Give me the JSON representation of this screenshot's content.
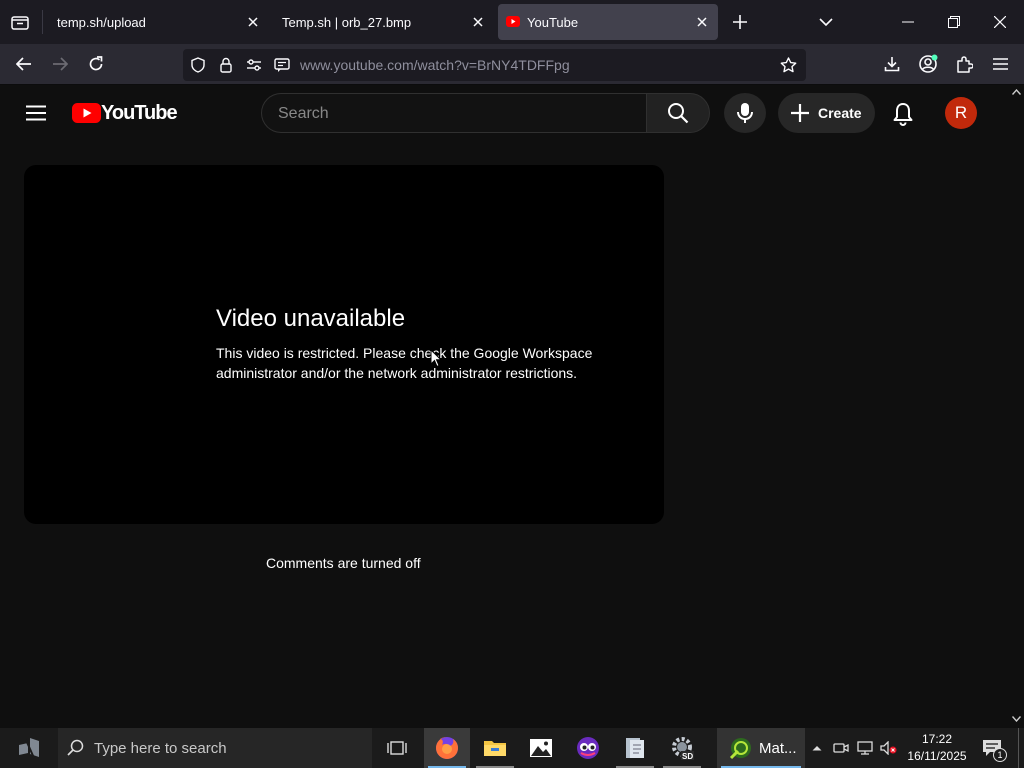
{
  "browser": {
    "tabs": [
      {
        "title": "temp.sh/upload",
        "active": false
      },
      {
        "title": "Temp.sh | orb_27.bmp",
        "active": false
      },
      {
        "title": "YouTube",
        "active": true
      }
    ],
    "url": "www.youtube.com/watch?v=BrNY4TDFFpg"
  },
  "youtube": {
    "logo_text": "YouTube",
    "search_placeholder": "Search",
    "create_label": "Create",
    "avatar_letter": "R",
    "error_title": "Video unavailable",
    "error_message": "This video is restricted. Please check the Google Workspace administrator and/or the network administrator restrictions.",
    "comments_status": "Comments are turned off"
  },
  "taskbar": {
    "search_placeholder": "Type here to search",
    "matlab_label": "Mat...",
    "time": "17:22",
    "date": "16/11/2025",
    "notification_count": "1",
    "apps": [
      "firefox-icon",
      "file-explorer-icon",
      "photos-icon",
      "app-icon",
      "document-icon",
      "gear-app-icon"
    ]
  },
  "colors": {
    "youtube_red": "#ff0000",
    "avatar_bg": "#c1290b",
    "page_bg": "#0f0f0f",
    "tab_strip_bg": "#1c1b22"
  }
}
